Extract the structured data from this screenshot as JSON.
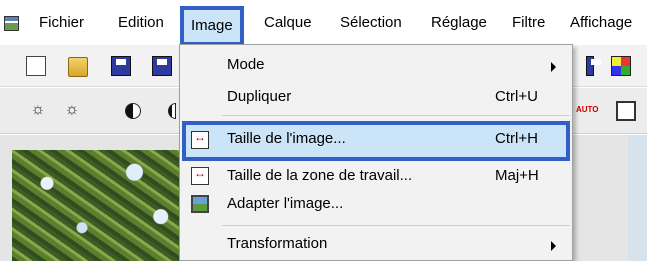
{
  "menubar": {
    "items": [
      "Fichier",
      "Edition",
      "Image",
      "Calque",
      "Sélection",
      "Réglage",
      "Filtre",
      "Affichage"
    ],
    "active": "Image"
  },
  "dropdown": {
    "items": [
      {
        "label": "Mode",
        "shortcut": "",
        "submenu": true,
        "icon": ""
      },
      {
        "label": "Dupliquer",
        "shortcut": "Ctrl+U",
        "submenu": false,
        "icon": ""
      },
      {
        "label": "Taille de l'image...",
        "shortcut": "Ctrl+H",
        "submenu": false,
        "icon": "resize-image-icon",
        "highlighted": true
      },
      {
        "label": "Taille de la zone de travail...",
        "shortcut": "Maj+H",
        "submenu": false,
        "icon": "canvas-size-icon"
      },
      {
        "label": "Adapter l'image...",
        "shortcut": "",
        "submenu": false,
        "icon": "fit-image-icon"
      },
      {
        "label": "Transformation",
        "shortcut": "",
        "submenu": true,
        "icon": ""
      }
    ]
  },
  "toolbar_auto_label": "AUTO",
  "colors": {
    "highlight_border": "#2f5fc7",
    "highlight_fill": "#cce4f7",
    "menu_bg": "#f2f2f2"
  }
}
